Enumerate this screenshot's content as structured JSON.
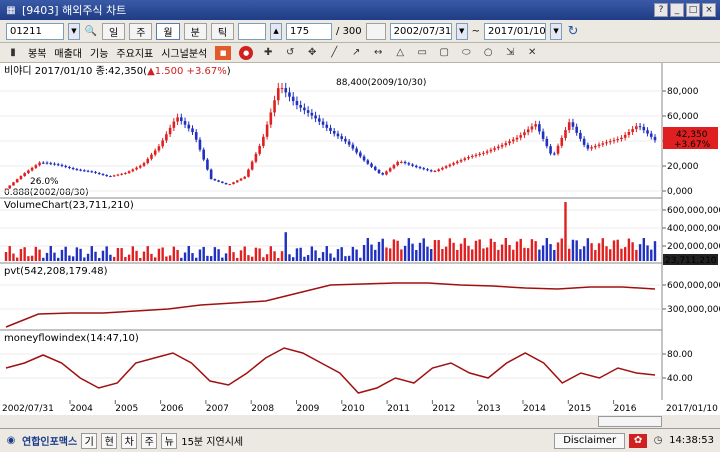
{
  "window": {
    "title": "[9403] 해외주식 차트",
    "controls": [
      "?",
      "_",
      "□",
      "×"
    ]
  },
  "toolbar": {
    "symbol": "01211",
    "periods": [
      "일",
      "주",
      "월",
      "분",
      "틱"
    ],
    "active_period": "월",
    "count_display": "175",
    "count_total": "/ 300",
    "start_date": "2002/07/31",
    "end_date": "2017/01/10"
  },
  "toolbar2": {
    "menus": [
      "봉복",
      "매출대",
      "기능",
      "주요지표",
      "시그널분석"
    ],
    "tools": [
      "crosshair-icon",
      "line-icon",
      "rect-icon",
      "ellipse-icon",
      "circle-icon",
      "cursor-icon",
      "pointer-icon"
    ]
  },
  "price_panel": {
    "label": "비야디 2017/01/10 종:42,350(",
    "change": "▲1.500 +3.67%",
    "label_end": ")",
    "high_annotation": "88,400(2009/10/30)",
    "low_annotation": "0.888(2002/08/30)",
    "low_pct": "26.0%",
    "current_value": "42,350",
    "current_change": "+3.67%",
    "yticks": [
      "80,000",
      "60,000",
      "40,000",
      "20,000",
      "0,000"
    ]
  },
  "volume_panel": {
    "label": "VolumeChart(23,711,210)",
    "current_value": "23,711,210",
    "yticks": [
      "600,000,000",
      "400,000,000",
      "200,000,000"
    ]
  },
  "pvt_panel": {
    "label": "pvt(542,208,179.48)",
    "yticks": [
      "600,000,000",
      "300,000,000"
    ]
  },
  "mfi_panel": {
    "label": "moneyflowindex(14:47,10)",
    "yticks": [
      "80.00",
      "40.00"
    ]
  },
  "xaxis": {
    "start": "2002/07/31",
    "end": "2017/01/10",
    "years": [
      "2004",
      "2005",
      "2006",
      "2007",
      "2008",
      "2009",
      "2010",
      "2011",
      "2012",
      "2013",
      "2014",
      "2015",
      "2016"
    ]
  },
  "statusbar": {
    "brand": "연합인포맥스",
    "buttons": [
      "기",
      "현",
      "차",
      "주",
      "뉴"
    ],
    "delay_text": "15분 지연시세",
    "disclaimer": "Disclaimer",
    "time": "14:38:53"
  },
  "chart_data": {
    "type": "line",
    "title": "비야디 2017/01/10 종:42,350",
    "x": [
      "2002/08",
      "2003/06",
      "2004/01",
      "2004/06",
      "2005/01",
      "2005/06",
      "2006/01",
      "2006/06",
      "2007/01",
      "2007/06",
      "2007/10",
      "2008/01",
      "2008/06",
      "2008/10",
      "2009/01",
      "2009/05",
      "2009/10",
      "2010/01",
      "2010/06",
      "2010/10",
      "2011/01",
      "2011/06",
      "2011/10",
      "2012/01",
      "2012/06",
      "2012/10",
      "2013/01",
      "2013/06",
      "2013/10",
      "2014/01",
      "2014/06",
      "2014/10",
      "2015/01",
      "2015/06",
      "2015/10",
      "2016/01",
      "2016/06",
      "2016/10",
      "2017/01"
    ],
    "series": [
      {
        "values": [
          2000,
          14000,
          24000,
          22000,
          18000,
          16000,
          12000,
          15000,
          22000,
          38000,
          62000,
          48000,
          10000,
          5000,
          12000,
          42000,
          88400,
          72000,
          62000,
          50000,
          40000,
          25000,
          13000,
          25000,
          20000,
          16000,
          22000,
          28000,
          32000,
          38000,
          45000,
          56000,
          28000,
          58000,
          35000,
          40000,
          44000,
          55000,
          42350
        ]
      }
    ],
    "ylim": [
      0,
      90000
    ]
  }
}
